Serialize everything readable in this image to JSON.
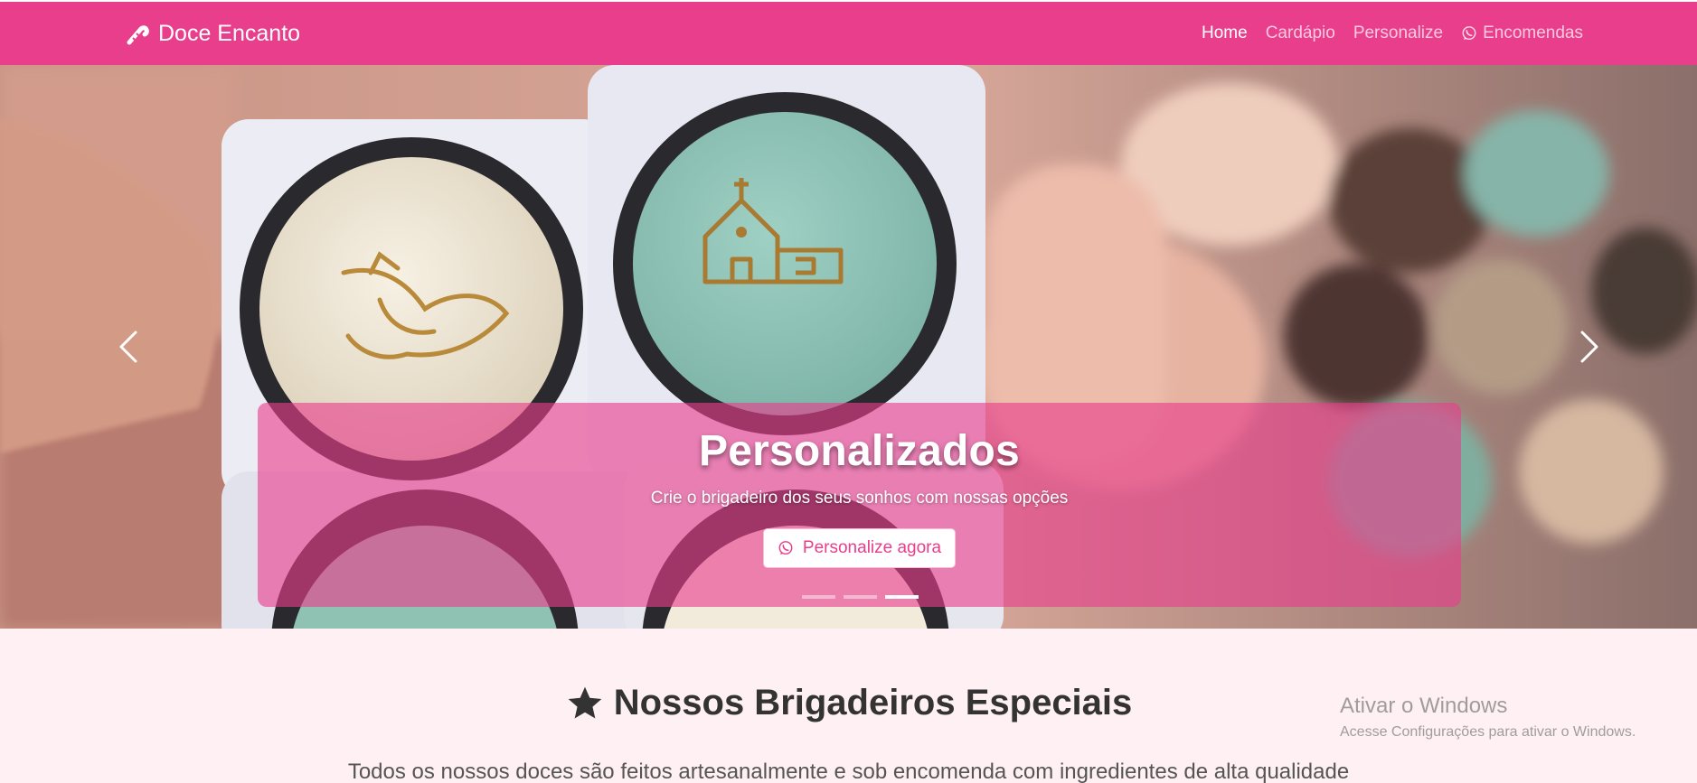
{
  "navbar": {
    "brand": "Doce Encanto",
    "brand_icon": "candy-cane-icon",
    "links": [
      "Home",
      "Cardápio",
      "Personalize",
      "Encomendas"
    ],
    "whatsapp_icon": "whatsapp-icon",
    "color": "#e83e8c"
  },
  "hero": {
    "title": "Personalizados",
    "subtitle": "Crie o brigadeiro dos seus sonhos com nossas opções",
    "cta_label": "Personalize agora",
    "slides_count": 3,
    "active_slide": 3
  },
  "section": {
    "title": "Nossos Brigadeiros Especiais",
    "title_icon": "star-icon",
    "text": "Todos os nossos doces são feitos artesanalmente e sob encomenda com ingredientes de alta qualidade"
  },
  "watermark": {
    "title": "Ativar o Windows",
    "subtitle": "Acesse Configurações para ativar o Windows."
  }
}
